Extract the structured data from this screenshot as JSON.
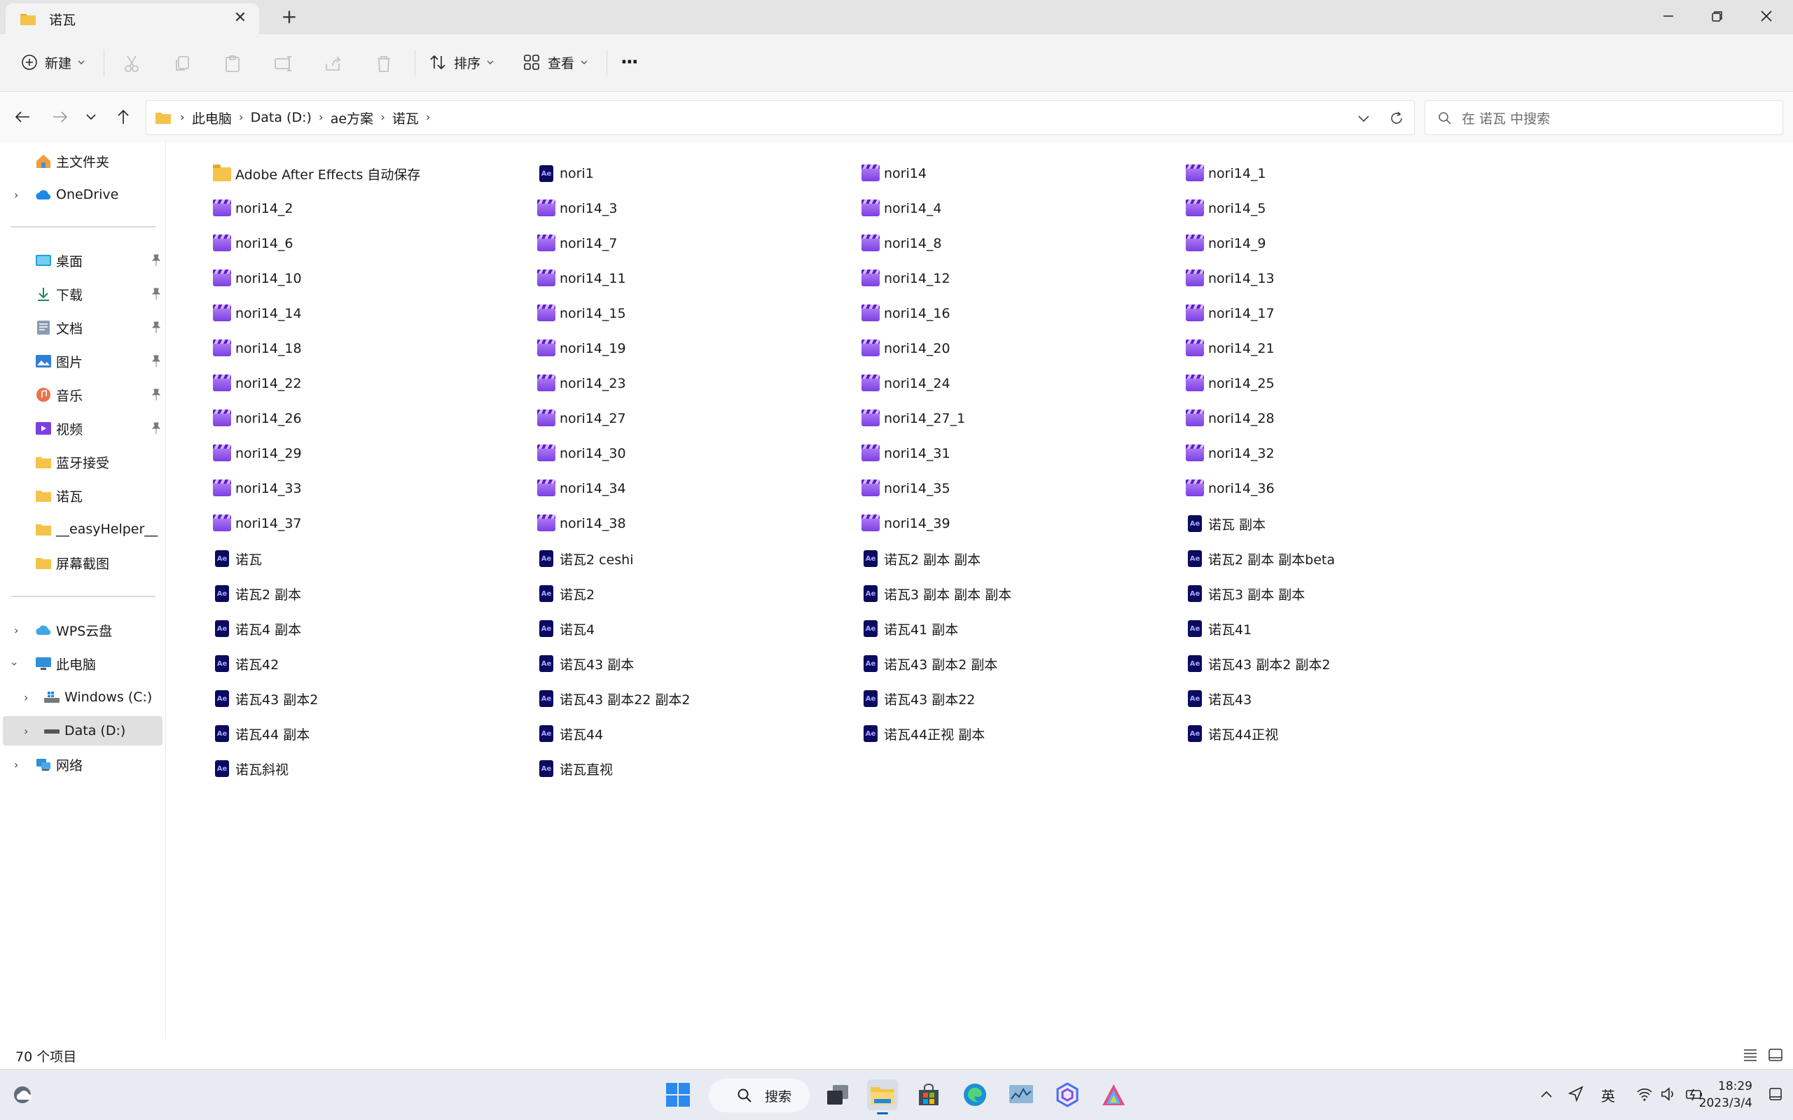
{
  "window": {
    "tab_title": "诺瓦",
    "tab_close": "✕",
    "new_tab": "+"
  },
  "toolbar": {
    "new_label": "新建",
    "sort_label": "排序",
    "view_label": "查看",
    "more": "···"
  },
  "address": {
    "crumbs": [
      "此电脑",
      "Data (D:)",
      "ae方案",
      "诺瓦"
    ],
    "separator": "›"
  },
  "search": {
    "placeholder": "在 诺瓦 中搜索"
  },
  "sidebar": {
    "home": "主文件夹",
    "onedrive": "OneDrive",
    "quick": [
      {
        "label": "桌面",
        "icon": "desktop-icon"
      },
      {
        "label": "下载",
        "icon": "download-icon"
      },
      {
        "label": "文档",
        "icon": "documents-icon"
      },
      {
        "label": "图片",
        "icon": "pictures-icon"
      },
      {
        "label": "音乐",
        "icon": "music-icon"
      },
      {
        "label": "视频",
        "icon": "videos-icon"
      },
      {
        "label": "蓝牙接受",
        "icon": "folder-icon"
      },
      {
        "label": "诺瓦",
        "icon": "folder-icon"
      },
      {
        "label": "__easyHelper__",
        "icon": "folder-icon"
      },
      {
        "label": "屏幕截图",
        "icon": "folder-icon"
      }
    ],
    "wps": "WPS云盘",
    "this_pc": "此电脑",
    "drive_c": "Windows (C:)",
    "drive_d": "Data (D:)",
    "network": "网络"
  },
  "files": [
    {
      "name": "Adobe After Effects 自动保存",
      "type": "folder"
    },
    {
      "name": "nori1",
      "type": "aep"
    },
    {
      "name": "nori14",
      "type": "video"
    },
    {
      "name": "nori14_1",
      "type": "video"
    },
    {
      "name": "nori14_2",
      "type": "video"
    },
    {
      "name": "nori14_3",
      "type": "video"
    },
    {
      "name": "nori14_4",
      "type": "video"
    },
    {
      "name": "nori14_5",
      "type": "video"
    },
    {
      "name": "nori14_6",
      "type": "video"
    },
    {
      "name": "nori14_7",
      "type": "video"
    },
    {
      "name": "nori14_8",
      "type": "video"
    },
    {
      "name": "nori14_9",
      "type": "video"
    },
    {
      "name": "nori14_10",
      "type": "video"
    },
    {
      "name": "nori14_11",
      "type": "video"
    },
    {
      "name": "nori14_12",
      "type": "video"
    },
    {
      "name": "nori14_13",
      "type": "video"
    },
    {
      "name": "nori14_14",
      "type": "video"
    },
    {
      "name": "nori14_15",
      "type": "video"
    },
    {
      "name": "nori14_16",
      "type": "video"
    },
    {
      "name": "nori14_17",
      "type": "video"
    },
    {
      "name": "nori14_18",
      "type": "video"
    },
    {
      "name": "nori14_19",
      "type": "video"
    },
    {
      "name": "nori14_20",
      "type": "video"
    },
    {
      "name": "nori14_21",
      "type": "video"
    },
    {
      "name": "nori14_22",
      "type": "video"
    },
    {
      "name": "nori14_23",
      "type": "video"
    },
    {
      "name": "nori14_24",
      "type": "video"
    },
    {
      "name": "nori14_25",
      "type": "video"
    },
    {
      "name": "nori14_26",
      "type": "video"
    },
    {
      "name": "nori14_27",
      "type": "video"
    },
    {
      "name": "nori14_27_1",
      "type": "video"
    },
    {
      "name": "nori14_28",
      "type": "video"
    },
    {
      "name": "nori14_29",
      "type": "video"
    },
    {
      "name": "nori14_30",
      "type": "video"
    },
    {
      "name": "nori14_31",
      "type": "video"
    },
    {
      "name": "nori14_32",
      "type": "video"
    },
    {
      "name": "nori14_33",
      "type": "video"
    },
    {
      "name": "nori14_34",
      "type": "video"
    },
    {
      "name": "nori14_35",
      "type": "video"
    },
    {
      "name": "nori14_36",
      "type": "video"
    },
    {
      "name": "nori14_37",
      "type": "video"
    },
    {
      "name": "nori14_38",
      "type": "video"
    },
    {
      "name": "nori14_39",
      "type": "video"
    },
    {
      "name": "诺瓦 副本",
      "type": "aep"
    },
    {
      "name": "诺瓦",
      "type": "aep"
    },
    {
      "name": "诺瓦2 ceshi",
      "type": "aep"
    },
    {
      "name": "诺瓦2 副本 副本",
      "type": "aep"
    },
    {
      "name": "诺瓦2 副本 副本beta",
      "type": "aep"
    },
    {
      "name": "诺瓦2 副本",
      "type": "aep"
    },
    {
      "name": "诺瓦2",
      "type": "aep"
    },
    {
      "name": "诺瓦3 副本 副本 副本",
      "type": "aep"
    },
    {
      "name": "诺瓦3 副本 副本",
      "type": "aep"
    },
    {
      "name": "诺瓦4 副本",
      "type": "aep"
    },
    {
      "name": "诺瓦4",
      "type": "aep"
    },
    {
      "name": "诺瓦41 副本",
      "type": "aep"
    },
    {
      "name": "诺瓦41",
      "type": "aep"
    },
    {
      "name": "诺瓦42",
      "type": "aep"
    },
    {
      "name": "诺瓦43 副本",
      "type": "aep"
    },
    {
      "name": "诺瓦43 副本2 副本",
      "type": "aep"
    },
    {
      "name": "诺瓦43 副本2 副本2",
      "type": "aep"
    },
    {
      "name": "诺瓦43 副本2",
      "type": "aep"
    },
    {
      "name": "诺瓦43 副本22 副本2",
      "type": "aep"
    },
    {
      "name": "诺瓦43 副本22",
      "type": "aep"
    },
    {
      "name": "诺瓦43",
      "type": "aep"
    },
    {
      "name": "诺瓦44 副本",
      "type": "aep"
    },
    {
      "name": "诺瓦44",
      "type": "aep"
    },
    {
      "name": "诺瓦44正视 副本",
      "type": "aep"
    },
    {
      "name": "诺瓦44正视",
      "type": "aep"
    },
    {
      "name": "诺瓦斜视",
      "type": "aep"
    },
    {
      "name": "诺瓦直视",
      "type": "aep"
    }
  ],
  "status": {
    "item_count": "70 个项目"
  },
  "taskbar": {
    "search_label": "搜索",
    "ime": "英",
    "time": "18:29",
    "date": "2023/3/4"
  },
  "colors": {
    "accent": "#0067c0",
    "folder": "#f5c34a",
    "aep": "#0a0a5e",
    "video": "#7b3fe4"
  }
}
